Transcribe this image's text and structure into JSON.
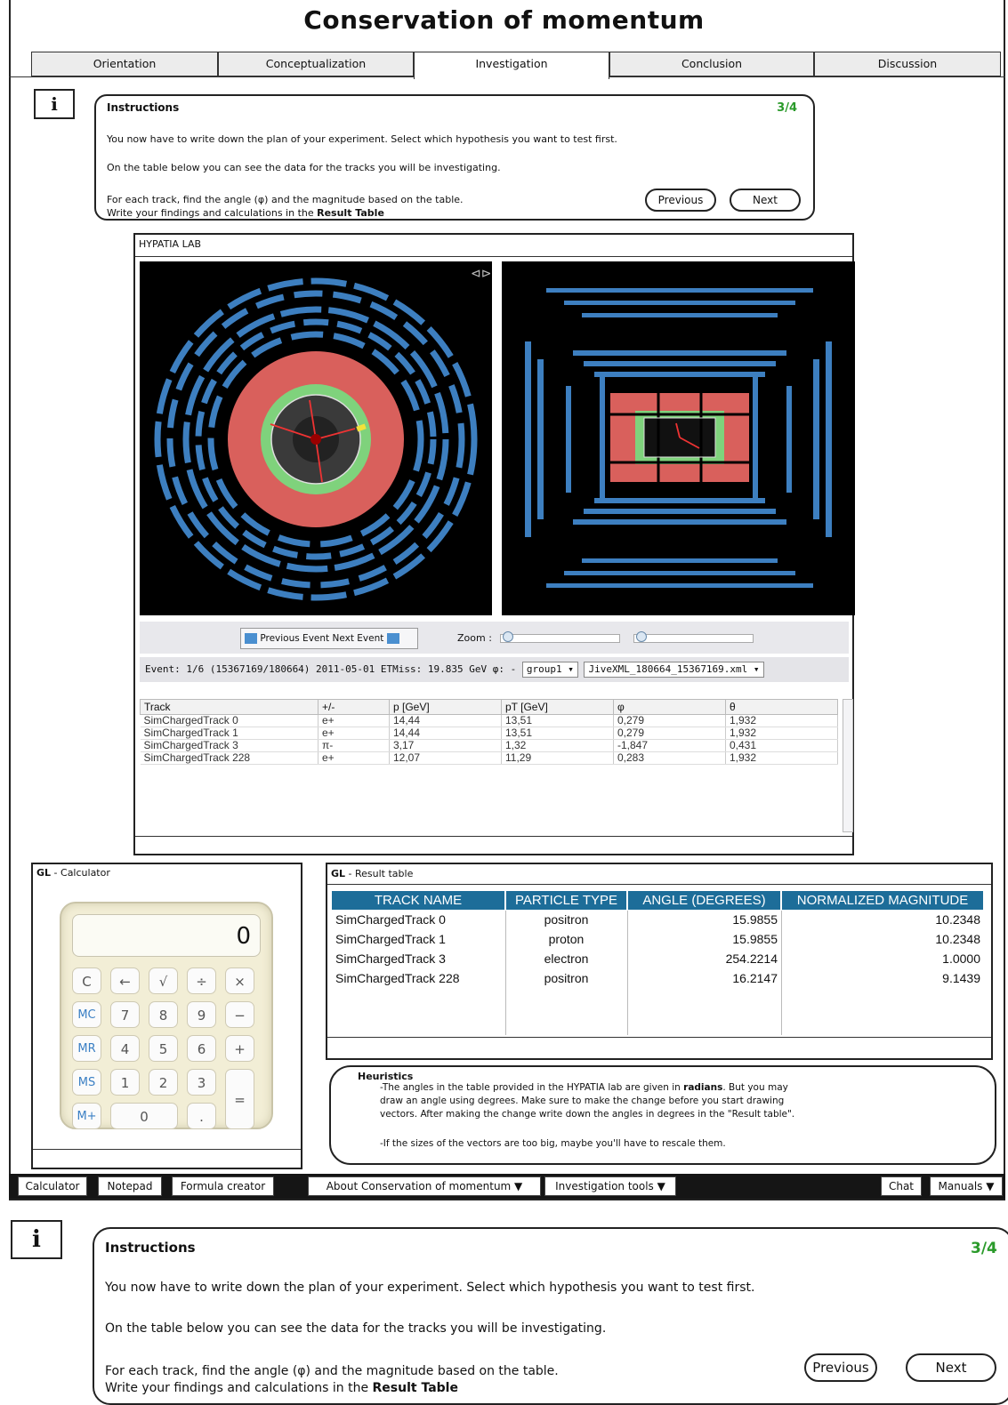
{
  "title": "Conservation of momentum",
  "tabs": [
    "Orientation",
    "Conceptualization",
    "Investigation",
    "Conclusion",
    "Discussion"
  ],
  "instructions": {
    "title": "Instructions",
    "step": "3/4",
    "line1": "You now have to write down the plan of your experiment. Select which hypothesis you want to test first.",
    "line2": "On the table below you can see the data for the tracks you will be investigating.",
    "line3": "For each track, find the angle (φ) and the magnitude based on the table.",
    "line4_prefix": "Write your findings and calculations in the ",
    "line4_bold": "Result Table",
    "previous": "Previous",
    "next": "Next"
  },
  "hypatia": {
    "title": "HYPATIA LAB",
    "prev_event": "Previous Event",
    "next_event": "Next Event",
    "zoom_label": "Zoom :",
    "event_info": "Event: 1/6 (15367169/180664)  2011-05-01  ETMiss: 19.835 GeV  φ: -",
    "group_select": "group1",
    "file_select": "JiveXML_180664_15367169.xml",
    "columns": [
      "Track",
      "+/-",
      "p [GeV]",
      "pT [GeV]",
      "φ",
      "θ"
    ],
    "rows": [
      [
        "SimChargedTrack 0",
        "e+",
        "14,44",
        "13,51",
        "0,279",
        "1,932"
      ],
      [
        "SimChargedTrack 1",
        "e+",
        "14,44",
        "13,51",
        "0,279",
        "1,932"
      ],
      [
        "SimChargedTrack 3",
        "π-",
        "3,17",
        "1,32",
        "-1,847",
        "0,431"
      ],
      [
        "SimChargedTrack 228",
        "e+",
        "12,07",
        "11,29",
        "0,283",
        "1,932"
      ]
    ]
  },
  "calculator": {
    "title_bold": "GL",
    "title_rest": " - Calculator",
    "display": "0",
    "keys": [
      "C",
      "←",
      "√",
      "÷",
      "×",
      "MC",
      "7",
      "8",
      "9",
      "−",
      "MR",
      "4",
      "5",
      "6",
      "+",
      "MS",
      "1",
      "2",
      "3",
      "=",
      "M+",
      "0",
      "."
    ]
  },
  "result_table": {
    "title_bold": "GL",
    "title_rest": " - Result table",
    "columns": [
      "TRACK NAME",
      "PARTICLE TYPE",
      "ANGLE (DEGREES)",
      "NORMALIZED MAGNITUDE"
    ],
    "rows": [
      [
        "SimChargedTrack 0",
        "positron",
        "15.9855",
        "10.2348"
      ],
      [
        "SimChargedTrack 1",
        "proton",
        "15.9855",
        "10.2348"
      ],
      [
        "SimChargedTrack 3",
        "electron",
        "254.2214",
        "1.0000"
      ],
      [
        "SimChargedTrack 228",
        "positron",
        "16.2147",
        "9.1439"
      ]
    ]
  },
  "heuristics": {
    "title": "Heuristics",
    "p1_a": "-The angles in the table provided in the HYPATIA lab are given in ",
    "p1_bold": "radians",
    "p1_b": ". But you may",
    "p1_line2": "draw an angle using degrees. Make sure to make the change before you start drawing",
    "p1_line3": "vectors.  After making the change write down the angles in degrees in the \"Result table\".",
    "p2": "-If the sizes of the vectors are too big, maybe you'll have to rescale them."
  },
  "bottom_bar": {
    "calculator": "Calculator",
    "notepad": "Notepad",
    "formula": "Formula creator",
    "about": "About Conservation of momentum ▼",
    "tools": "Investigation tools ▼",
    "chat": "Chat",
    "manuals": "Manuals ▼"
  },
  "colors": {
    "step_green": "#2a9a2a",
    "header_blue": "#1d6d99",
    "muon_blue": "#3d7fc0",
    "calorimeter_red": "#d9605c",
    "tracker_green": "#7fd27c"
  }
}
